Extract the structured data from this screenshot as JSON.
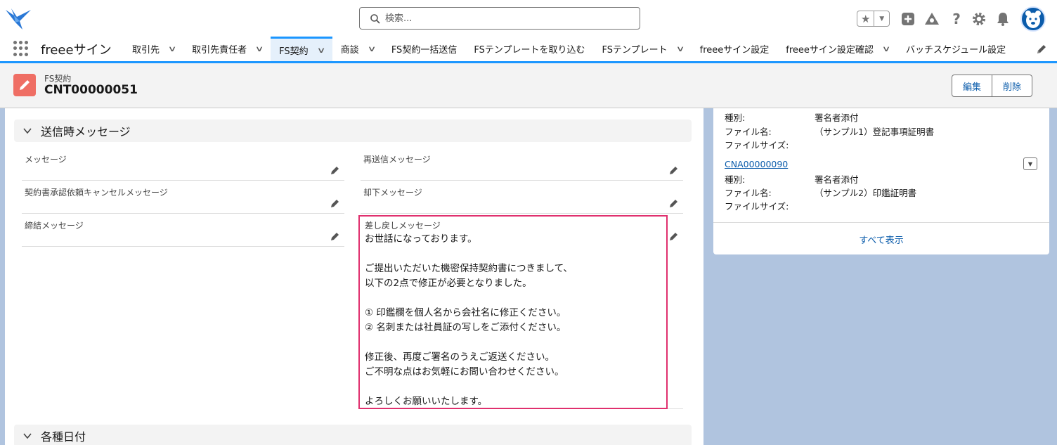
{
  "header": {
    "search_placeholder": "検索...",
    "icons": [
      "favorites-star-icon",
      "add-icon",
      "trailhead-icon",
      "help-icon",
      "setup-gear-icon",
      "notification-bell-icon"
    ]
  },
  "nav": {
    "app_name": "freeeサイン",
    "items": [
      {
        "label": "取引先",
        "dropdown": true
      },
      {
        "label": "取引先責任者",
        "dropdown": true
      },
      {
        "label": "FS契約",
        "dropdown": true,
        "active": true
      },
      {
        "label": "商談",
        "dropdown": true
      },
      {
        "label": "FS契約一括送信",
        "dropdown": false
      },
      {
        "label": "FSテンプレートを取り込む",
        "dropdown": false
      },
      {
        "label": "FSテンプレート",
        "dropdown": true
      },
      {
        "label": "freeeサイン設定",
        "dropdown": false
      },
      {
        "label": "freeeサイン設定確認",
        "dropdown": true
      },
      {
        "label": "バッチスケジュール設定",
        "dropdown": false
      }
    ]
  },
  "record": {
    "object_label": "FS契約",
    "name": "CNT00000051",
    "edit_label": "編集",
    "delete_label": "削除"
  },
  "sections": {
    "messages_title": "送信時メッセージ",
    "dates_title": "各種日付"
  },
  "fields": {
    "message": "メッセージ",
    "resend_message": "再送信メッセージ",
    "cancel_message": "契約書承認依頼キャンセルメッセージ",
    "reject_message": "却下メッセージ",
    "conclude_message": "締結メッセージ",
    "return_message": "差し戻しメッセージ",
    "return_message_value": "お世話になっております。\n\nご提出いただいた機密保持契約書につきまして、\n以下の2点で修正が必要となりました。\n\n① 印鑑欄を個人名から会社名に修正ください。\n② 名刺または社員証の写しをご添付ください。\n\n修正後、再度ご署名のうえご返送ください。\nご不明な点はお気軽にお問い合わせください。\n\nよろしくお願いいたします。"
  },
  "attachments": {
    "labels": {
      "type": "種別:",
      "file_name": "ファイル名:",
      "file_size": "ファイルサイズ:"
    },
    "items": [
      {
        "type": "署名者添付",
        "file_name": "（サンプル1）登記事項証明書",
        "file_size": ""
      },
      {
        "id": "CNA00000090",
        "type": "署名者添付",
        "file_name": "（サンプル2）印鑑証明書",
        "file_size": ""
      }
    ],
    "view_all": "すべて表示"
  },
  "colors": {
    "brand_blue": "#1b96ff",
    "link_blue": "#0b5cab",
    "record_icon": "#ef6e64",
    "highlight": "#e0306e"
  }
}
